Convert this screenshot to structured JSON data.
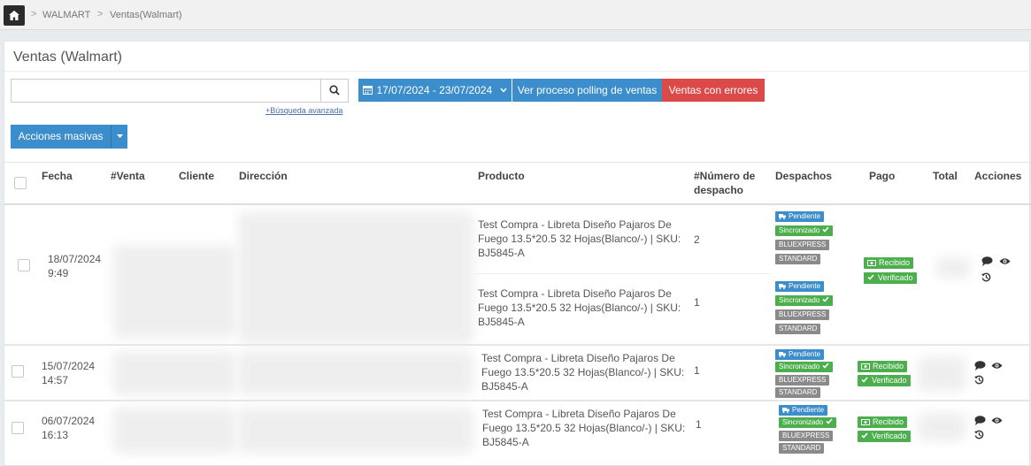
{
  "breadcrumb": {
    "home_icon": "home-icon",
    "items": [
      "WALMART",
      "Ventas(Walmart)"
    ],
    "separator": ">"
  },
  "page": {
    "title": "Ventas (Walmart)"
  },
  "search": {
    "value": "",
    "placeholder": "",
    "advanced_label": "+Búsqueda avanzada"
  },
  "toolbar": {
    "date_range": "17/07/2024 - 23/07/2024",
    "polling_label": "Ver proceso polling de ventas",
    "errors_label": "Ventas con errores",
    "bulk_label": "Acciones masivas"
  },
  "table": {
    "headers": {
      "fecha": "Fecha",
      "venta": "#Venta",
      "cliente": "Cliente",
      "direccion": "Dirección",
      "producto": "Producto",
      "despacho_1": "#Número de",
      "despacho_2": "despacho",
      "despachos": "Despachos",
      "pago": "Pago",
      "total": "Total",
      "acciones": "Acciones"
    },
    "rows": [
      {
        "date": "18/07/2024",
        "time": "9:49",
        "items": [
          {
            "product_1": "Test Compra - Libreta Diseño Pajaros De",
            "product_2": "Fuego 13.5*20.5 32 Hojas(Blanco/-) | SKU:",
            "product_3": "BJ5845-A",
            "dispatch_no": "2"
          },
          {
            "product_1": "Test Compra - Libreta Diseño Pajaros De",
            "product_2": "Fuego 13.5*20.5 32 Hojas(Blanco/-) | SKU:",
            "product_3": "BJ5845-A",
            "dispatch_no": "1"
          }
        ]
      },
      {
        "date": "15/07/2024",
        "time": "14:57",
        "items": [
          {
            "product_1": "Test Compra - Libreta Diseño Pajaros De",
            "product_2": "Fuego 13.5*20.5 32 Hojas(Blanco/-) | SKU:",
            "product_3": "BJ5845-A",
            "dispatch_no": "1"
          }
        ]
      },
      {
        "date": "06/07/2024",
        "time": "16:13",
        "items": [
          {
            "product_1": "Test Compra - Libreta Diseño Pajaros De",
            "product_2": "Fuego 13.5*20.5 32 Hojas(Blanco/-) | SKU:",
            "product_3": "BJ5845-A",
            "dispatch_no": "1"
          }
        ]
      }
    ],
    "badges": {
      "pending": "Pendiente",
      "synced": "Sincronizado",
      "carrier": "BLUEXPRESS",
      "service": "STANDARD",
      "received": "Recibido",
      "verified": "Verificado"
    }
  },
  "colors": {
    "primary": "#3c8dcb",
    "danger": "#db4a48",
    "success": "#4cae4c",
    "muted": "#8a8a8a"
  }
}
